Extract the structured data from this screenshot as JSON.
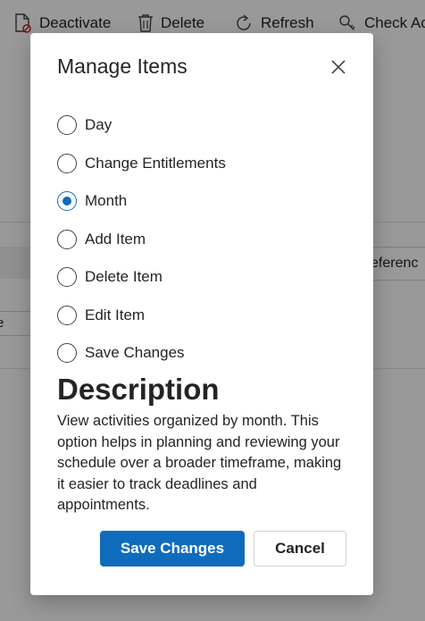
{
  "toolbar": {
    "deactivate_label": "Deactivate",
    "delete_label": "Delete",
    "refresh_label": "Refresh",
    "check_label": "Check Ac"
  },
  "background": {
    "reference_text": "eferenc",
    "input_text": "e"
  },
  "dialog": {
    "title": "Manage Items",
    "options": [
      {
        "label": "Day",
        "checked": false
      },
      {
        "label": "Change Entitlements",
        "checked": false
      },
      {
        "label": "Month",
        "checked": true
      },
      {
        "label": "Add Item",
        "checked": false
      },
      {
        "label": "Delete Item",
        "checked": false
      },
      {
        "label": "Edit Item",
        "checked": false
      },
      {
        "label": "Save Changes",
        "checked": false
      }
    ],
    "description_heading": "Description",
    "description_text": "View activities organized by month. This option helps in planning and reviewing your schedule over a broader timeframe, making it easier to track deadlines and appointments.",
    "primary_button": "Save Changes",
    "secondary_button": "Cancel"
  },
  "colors": {
    "accent": "#0f6cbd",
    "overlay": "rgba(0,0,0,0.4)"
  }
}
